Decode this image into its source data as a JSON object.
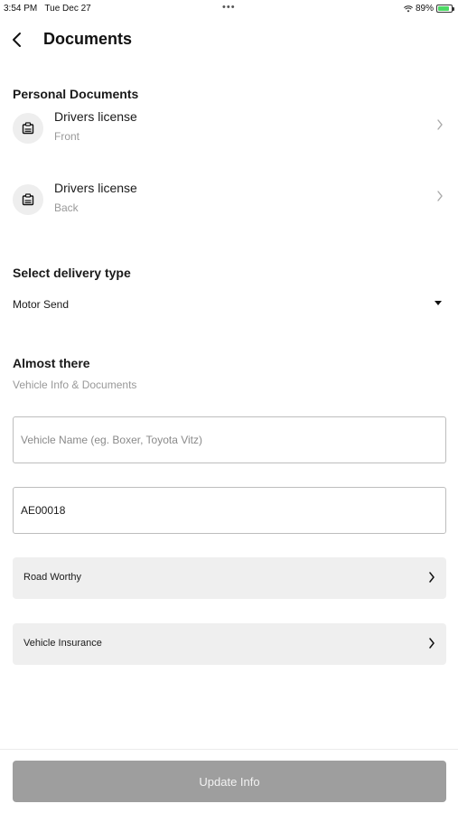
{
  "status_bar": {
    "time": "3:54 PM",
    "date": "Tue Dec 27",
    "dots": "•••",
    "battery": "89%",
    "battery_level": 0.89,
    "battery_color": "#4cd964"
  },
  "header": {
    "back_icon": "chevron-left-icon",
    "title": "Documents"
  },
  "personal_documents": {
    "section_title": "Personal Documents",
    "items": [
      {
        "icon": "id-card-icon",
        "title": "Drivers license",
        "subtitle": "Front"
      },
      {
        "icon": "id-card-icon",
        "title": "Drivers license",
        "subtitle": "Back"
      }
    ]
  },
  "delivery": {
    "section_title": "Select delivery type",
    "selected": "Motor Send"
  },
  "vehicle": {
    "section_title": "Almost there",
    "subtitle": "Vehicle Info & Documents",
    "name_placeholder": "Vehicle Name (eg. Boxer, Toyota Vitz)",
    "name_value": "",
    "plate_value": "AE00018",
    "road_worthy_label": "Road Worthy",
    "insurance_label": "Vehicle Insurance"
  },
  "footer": {
    "update_label": "Update Info",
    "button_color": "#9e9e9e"
  }
}
